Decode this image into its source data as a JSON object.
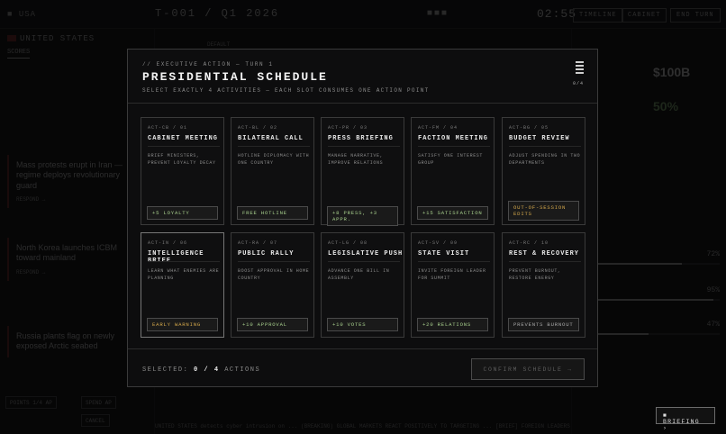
{
  "background": {
    "flag_country_short": "USA",
    "turn_label": "T-001 / Q1 2026",
    "clock": "02:55",
    "top_buttons": [
      "TIMELINE",
      "CABINET",
      "END TURN"
    ],
    "country": "UNITED STATES",
    "mini_tab": "SCORES",
    "news": [
      {
        "headline": "Mass protests erupt in Iran — regime deploys revolutionary guard",
        "respond": "RESPOND →"
      },
      {
        "headline": "North Korea launches ICBM toward mainland",
        "respond": "RESPOND →"
      },
      {
        "headline": "Russia plants flag on newly exposed Arctic seabed",
        "respond": ""
      }
    ],
    "left_buttons": [
      "POINTS 1/4 AP",
      "SPEND AP",
      "CANCEL"
    ],
    "mid_tabs": [
      "DEFAULT"
    ],
    "big_value": "$100B",
    "big_percent": "50%",
    "stats": [
      {
        "value": "72%",
        "fill": 0.72
      },
      {
        "value": "95%",
        "fill": 0.95
      },
      {
        "value": "47%",
        "fill": 0.47
      }
    ],
    "ticker": "UNITED STATES detects cyber intrusion on ...   (BREAKING) GLOBAL MARKETS REACT POSITIVELY TO TARGETING ...   [BRIEF] FOREIGN LEADERS S"
  },
  "modal": {
    "kicker": "// EXECUTIVE ACTION — TURN 1",
    "title": "PRESIDENTIAL SCHEDULE",
    "subtitle": "SELECT EXACTLY 4 ACTIVITIES — EACH SLOT CONSUMES ONE ACTION POINT",
    "ap_count": "0/4",
    "cards": [
      {
        "code": "ACT-CB / 01",
        "name": "CABINET MEETING",
        "desc": "BRIEF MINISTERS, PREVENT LOYALTY DECAY",
        "effect": "+5 LOYALTY",
        "tone": "green"
      },
      {
        "code": "ACT-BL / 02",
        "name": "BILATERAL CALL",
        "desc": "HOTLINE DIPLOMACY WITH ONE COUNTRY",
        "effect": "FREE HOTLINE",
        "tone": "green"
      },
      {
        "code": "ACT-PR / 03",
        "name": "PRESS BRIEFING",
        "desc": "MANAGE NARRATIVE, IMPROVE RELATIONS",
        "effect": "+8 PRESS, +3 APPR.",
        "tone": "green"
      },
      {
        "code": "ACT-FM / 04",
        "name": "FACTION MEETING",
        "desc": "SATISFY ONE INTEREST GROUP",
        "effect": "+15 SATISFACTION",
        "tone": "green"
      },
      {
        "code": "ACT-BG / 05",
        "name": "BUDGET REVIEW",
        "desc": "ADJUST SPENDING IN TWO DEPARTMENTS",
        "effect": "OUT-OF-SESSION EDITS",
        "tone": "amber"
      },
      {
        "code": "ACT-IN / 06",
        "name": "INTELLIGENCE BRIEF",
        "desc": "LEARN WHAT ENEMIES ARE PLANNING",
        "effect": "EARLY WARNING",
        "tone": "amber"
      },
      {
        "code": "ACT-RA / 07",
        "name": "PUBLIC RALLY",
        "desc": "BOOST APPROVAL IN HOME COUNTRY",
        "effect": "+10 APPROVAL",
        "tone": "green"
      },
      {
        "code": "ACT-LG / 08",
        "name": "LEGISLATIVE PUSH",
        "desc": "ADVANCE ONE BILL IN ASSEMBLY",
        "effect": "+10 VOTES",
        "tone": "green"
      },
      {
        "code": "ACT-SV / 09",
        "name": "STATE VISIT",
        "desc": "INVITE FOREIGN LEADER FOR SUMMIT",
        "effect": "+20 RELATIONS",
        "tone": "green"
      },
      {
        "code": "ACT-RC / 10",
        "name": "REST & RECOVERY",
        "desc": "PREVENT BURNOUT, RESTORE ENERGY",
        "effect": "PREVENTS BURNOUT",
        "tone": "gray"
      }
    ],
    "selected_prefix": "SELECTED:",
    "selected_count": "0 / 4",
    "selected_suffix": "ACTIONS",
    "confirm_label": "CONFIRM SCHEDULE →"
  },
  "briefing_label": "■ BRIEFING ›"
}
